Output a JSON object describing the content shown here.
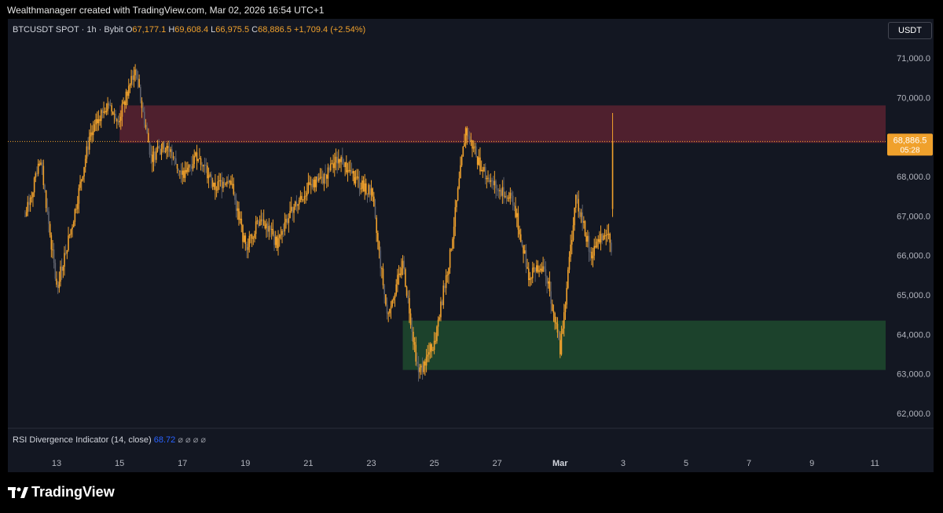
{
  "header": {
    "credit": "Wealthmanagerr created with TradingView.com, Mar 02, 2026 16:54 UTC+1"
  },
  "legend": {
    "symbol": "BTCUSDT SPOT · 1h · Bybit",
    "open_label": "O",
    "open": "67,177.1",
    "high_label": "H",
    "high": "69,608.4",
    "low_label": "L",
    "low": "66,975.5",
    "close_label": "C",
    "close": "68,886.5",
    "change": "+1,709.4 (+2.54%)"
  },
  "currency_button": "USDT",
  "price_badge": {
    "price": "68,886.5",
    "countdown": "05:28"
  },
  "rsi": {
    "name": "RSI Divergence Indicator (14, close)",
    "value": "68.72",
    "symbols": "⌀ ⌀ ⌀ ⌀"
  },
  "brand": {
    "name": "TradingView",
    "logo_text": "TV"
  },
  "colors": {
    "background": "#131722",
    "candle": "#f0a12c",
    "candle_dark": "#5d606b",
    "resistance_zone": "#5a2230",
    "support_zone": "#1f4a2e",
    "last_price": "#f0a12c",
    "rsi_value": "#2962ff"
  },
  "chart_data": {
    "type": "candlestick",
    "title": "BTCUSDT SPOT · 1h · Bybit",
    "y_ticks": [
      "71,000.0",
      "70,000.0",
      "69,000.0",
      "68,000.0",
      "67,000.0",
      "66,000.0",
      "65,000.0",
      "64,000.0",
      "63,000.0",
      "62,000.0"
    ],
    "x_ticks": [
      "13",
      "15",
      "17",
      "19",
      "21",
      "23",
      "25",
      "27",
      "Mar",
      "3",
      "5",
      "7",
      "9",
      "11"
    ],
    "ylim": [
      61700,
      72000
    ],
    "last_price": 68886.5,
    "zones": [
      {
        "name": "resistance",
        "from": "Feb 15",
        "to": "Mar 11",
        "y_low": 68850,
        "y_high": 69800
      },
      {
        "name": "support",
        "from": "Feb 24",
        "to": "Mar 11",
        "y_low": 63100,
        "y_high": 64350
      }
    ],
    "price_path": [
      {
        "date": "Feb 12 00:00",
        "price": 67000
      },
      {
        "date": "Feb 12 12:00",
        "price": 68400
      },
      {
        "date": "Feb 13 00:00",
        "price": 65200
      },
      {
        "date": "Feb 13 12:00",
        "price": 66800
      },
      {
        "date": "Feb 14 00:00",
        "price": 68800
      },
      {
        "date": "Feb 14 12:00",
        "price": 69800
      },
      {
        "date": "Feb 15 00:00",
        "price": 69500
      },
      {
        "date": "Feb 15 12:00",
        "price": 70700
      },
      {
        "date": "Feb 16 00:00",
        "price": 68500
      },
      {
        "date": "Feb 16 12:00",
        "price": 68800
      },
      {
        "date": "Feb 17 00:00",
        "price": 68000
      },
      {
        "date": "Feb 17 12:00",
        "price": 68600
      },
      {
        "date": "Feb 18 00:00",
        "price": 67700
      },
      {
        "date": "Feb 18 12:00",
        "price": 68000
      },
      {
        "date": "Feb 19 00:00",
        "price": 66200
      },
      {
        "date": "Feb 19 12:00",
        "price": 67000
      },
      {
        "date": "Feb 20 00:00",
        "price": 66300
      },
      {
        "date": "Feb 20 12:00",
        "price": 67200
      },
      {
        "date": "Feb 21 00:00",
        "price": 67700
      },
      {
        "date": "Feb 21 12:00",
        "price": 68000
      },
      {
        "date": "Feb 22 00:00",
        "price": 68500
      },
      {
        "date": "Feb 22 12:00",
        "price": 67900
      },
      {
        "date": "Feb 23 00:00",
        "price": 67600
      },
      {
        "date": "Feb 23 12:00",
        "price": 64500
      },
      {
        "date": "Feb 24 00:00",
        "price": 65800
      },
      {
        "date": "Feb 24 12:00",
        "price": 63000
      },
      {
        "date": "Feb 25 00:00",
        "price": 63800
      },
      {
        "date": "Feb 25 12:00",
        "price": 66000
      },
      {
        "date": "Feb 26 00:00",
        "price": 69200
      },
      {
        "date": "Feb 26 12:00",
        "price": 68200
      },
      {
        "date": "Feb 27 00:00",
        "price": 67700
      },
      {
        "date": "Feb 27 12:00",
        "price": 67400
      },
      {
        "date": "Feb 28 00:00",
        "price": 65500
      },
      {
        "date": "Feb 28 12:00",
        "price": 65800
      },
      {
        "date": "Mar 01 00:00",
        "price": 63600
      },
      {
        "date": "Mar 01 12:00",
        "price": 67500
      },
      {
        "date": "Mar 02 00:00",
        "price": 66000
      },
      {
        "date": "Mar 02 12:00",
        "price": 66700
      },
      {
        "date": "Mar 02 15:00",
        "price": 66000
      },
      {
        "date": "Mar 02 16:00",
        "price": 68886.5
      }
    ]
  }
}
